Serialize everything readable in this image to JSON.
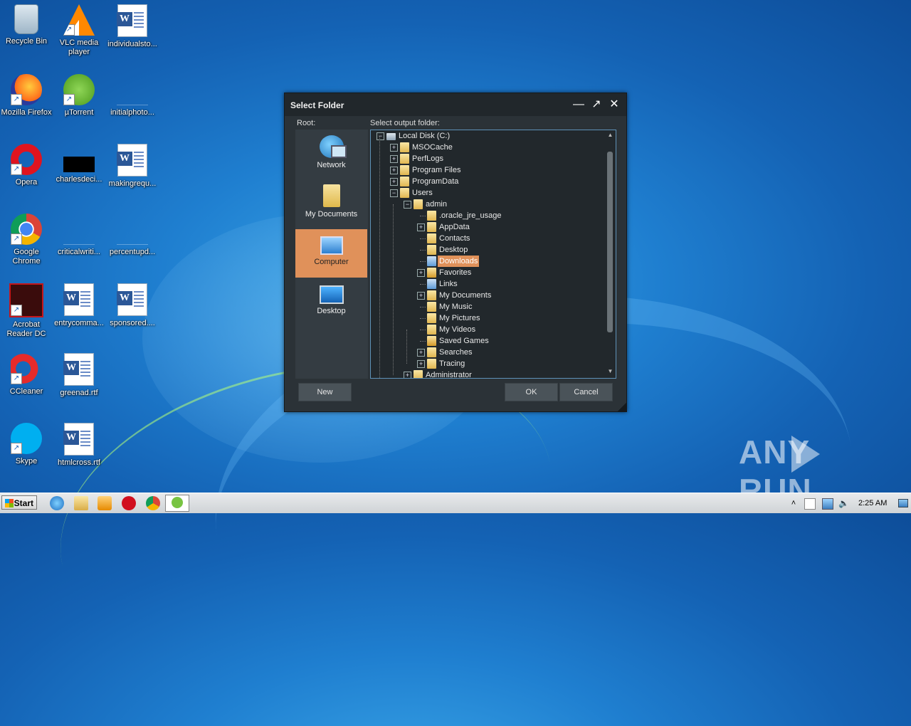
{
  "desktop": {
    "icons": [
      {
        "label": "Recycle Bin",
        "glyph": "recycle-bin-icon"
      },
      {
        "label": "VLC media player",
        "glyph": "vlc-icon"
      },
      {
        "label": "individualsto...",
        "glyph": "word-document-icon"
      },
      {
        "label": "Mozilla Firefox",
        "glyph": "firefox-icon"
      },
      {
        "label": "µTorrent",
        "glyph": "utorrent-icon"
      },
      {
        "label": "initialphoto...",
        "glyph": "blank-file-icon"
      },
      {
        "label": "Opera",
        "glyph": "opera-icon"
      },
      {
        "label": "charlesdeci...",
        "glyph": "black-image-icon"
      },
      {
        "label": "makingrequ...",
        "glyph": "word-document-icon"
      },
      {
        "label": "Google Chrome",
        "glyph": "chrome-icon"
      },
      {
        "label": "criticalwriti...",
        "glyph": "blank-file-icon"
      },
      {
        "label": "percentupd...",
        "glyph": "blank-file-icon"
      },
      {
        "label": "Acrobat Reader DC",
        "glyph": "acrobat-icon"
      },
      {
        "label": "entrycomma...",
        "glyph": "word-document-icon"
      },
      {
        "label": "sponsored....",
        "glyph": "word-document-icon"
      },
      {
        "label": "CCleaner",
        "glyph": "ccleaner-icon"
      },
      {
        "label": "greenad.rtf",
        "glyph": "word-document-icon"
      },
      {
        "label": "Skype",
        "glyph": "skype-icon"
      },
      {
        "label": "htmlcross.rtf",
        "glyph": "word-document-icon"
      }
    ]
  },
  "dialog": {
    "title": "Select Folder",
    "root_label": "Root:",
    "output_label": "Select output folder:",
    "roots": [
      {
        "label": "Network",
        "selected": false
      },
      {
        "label": "My Documents",
        "selected": false
      },
      {
        "label": "Computer",
        "selected": true
      },
      {
        "label": "Desktop",
        "selected": false
      }
    ],
    "tree": [
      {
        "label": "Local Disk (C:)",
        "level": 0,
        "expander": "−",
        "icon": "disk"
      },
      {
        "label": "MSOCache",
        "level": 1,
        "expander": "+",
        "icon": "folder"
      },
      {
        "label": "PerfLogs",
        "level": 1,
        "expander": "+",
        "icon": "folder"
      },
      {
        "label": "Program Files",
        "level": 1,
        "expander": "+",
        "icon": "folder"
      },
      {
        "label": "ProgramData",
        "level": 1,
        "expander": "+",
        "icon": "folder"
      },
      {
        "label": "Users",
        "level": 1,
        "expander": "−",
        "icon": "folder"
      },
      {
        "label": "admin",
        "level": 2,
        "expander": "−",
        "icon": "folder"
      },
      {
        "label": ".oracle_jre_usage",
        "level": 3,
        "expander": "",
        "icon": "folder"
      },
      {
        "label": "AppData",
        "level": 3,
        "expander": "+",
        "icon": "folder"
      },
      {
        "label": "Contacts",
        "level": 3,
        "expander": "",
        "icon": "folder"
      },
      {
        "label": "Desktop",
        "level": 3,
        "expander": "",
        "icon": "folder"
      },
      {
        "label": "Downloads",
        "level": 3,
        "expander": "",
        "icon": "downloads",
        "selected": true
      },
      {
        "label": "Favorites",
        "level": 3,
        "expander": "+",
        "icon": "special"
      },
      {
        "label": "Links",
        "level": 3,
        "expander": "",
        "icon": "downloads"
      },
      {
        "label": "My Documents",
        "level": 3,
        "expander": "+",
        "icon": "folder"
      },
      {
        "label": "My Music",
        "level": 3,
        "expander": "",
        "icon": "folder"
      },
      {
        "label": "My Pictures",
        "level": 3,
        "expander": "",
        "icon": "folder"
      },
      {
        "label": "My Videos",
        "level": 3,
        "expander": "",
        "icon": "folder"
      },
      {
        "label": "Saved Games",
        "level": 3,
        "expander": "",
        "icon": "special"
      },
      {
        "label": "Searches",
        "level": 3,
        "expander": "+",
        "icon": "folder"
      },
      {
        "label": "Tracing",
        "level": 3,
        "expander": "+",
        "icon": "folder"
      },
      {
        "label": "Administrator",
        "level": 2,
        "expander": "+",
        "icon": "folder"
      }
    ],
    "buttons": {
      "new": "New",
      "ok": "OK",
      "cancel": "Cancel"
    },
    "controls": {
      "minimize": "minimize-icon",
      "maximize": "maximize-icon",
      "close": "close-icon"
    }
  },
  "taskbar": {
    "start_label": "Start",
    "pinned": [
      "internet-explorer-icon",
      "explorer-folder-icon",
      "media-player-icon",
      "opera-icon",
      "chrome-icon",
      "utorrent-icon"
    ],
    "clock": "2:25 AM",
    "tray": [
      "show-hidden-icons-icon",
      "action-center-icon",
      "network-icon",
      "volume-icon"
    ]
  },
  "watermark": {
    "left": "ANY",
    "right": "RUN"
  }
}
